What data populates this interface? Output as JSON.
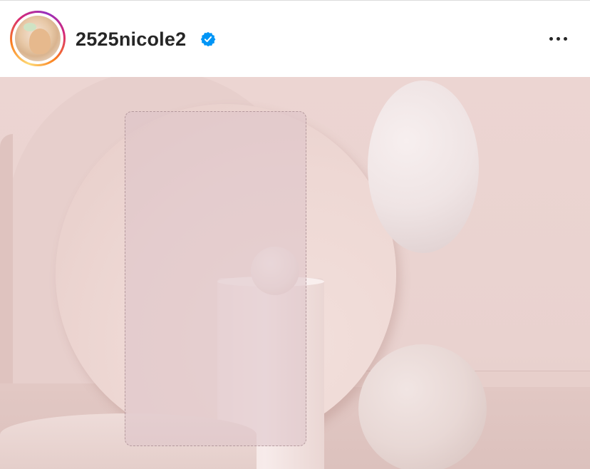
{
  "header": {
    "username": "2525nicole2",
    "verified": true,
    "more_icon": "more-horizontal-icon",
    "avatar_icon": "profile-avatar",
    "colors": {
      "username": "#262626",
      "verified_badge": "#0095f6",
      "story_ring": [
        "#feda75",
        "#fa7e1e",
        "#d62976",
        "#962fbf"
      ]
    }
  },
  "post": {
    "media_type": "photo",
    "colors": {
      "backdrop": "#ecd5d2",
      "accent_lilac": "#c8bfe8"
    }
  }
}
